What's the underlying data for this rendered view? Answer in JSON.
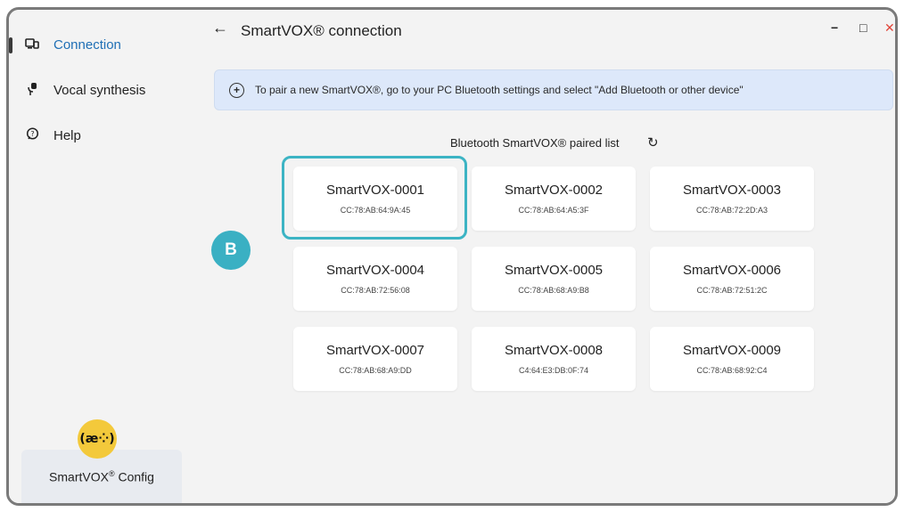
{
  "sidebar": {
    "items": [
      {
        "label": "Connection",
        "icon": "connection-icon",
        "active": true
      },
      {
        "label": "Vocal synthesis",
        "icon": "microphone-icon",
        "active": false
      },
      {
        "label": "Help",
        "icon": "help-icon",
        "active": false
      }
    ],
    "config": {
      "logo_text": "(æ⁘)",
      "label": "SmartVOX",
      "label_sup": "®",
      "label_suffix": " Config"
    }
  },
  "header": {
    "back": "←",
    "title": "SmartVOX® connection",
    "minimize": "−",
    "maximize": "□",
    "close": "✕"
  },
  "banner": {
    "icon": "+",
    "text": "To pair a new SmartVOX®, go to your PC Bluetooth settings and select \"Add Bluetooth or other device\""
  },
  "list": {
    "title": "Bluetooth SmartVOX® paired list",
    "refresh": "↻"
  },
  "devices": [
    {
      "name": "SmartVOX-0001",
      "mac": "CC:78:AB:64:9A:45"
    },
    {
      "name": "SmartVOX-0002",
      "mac": "CC:78:AB:64:A5:3F"
    },
    {
      "name": "SmartVOX-0003",
      "mac": "CC:78:AB:72:2D:A3"
    },
    {
      "name": "SmartVOX-0004",
      "mac": "CC:78:AB:72:56:08"
    },
    {
      "name": "SmartVOX-0005",
      "mac": "CC:78:AB:68:A9:B8"
    },
    {
      "name": "SmartVOX-0006",
      "mac": "CC:78:AB:72:51:2C"
    },
    {
      "name": "SmartVOX-0007",
      "mac": "CC:78:AB:68:A9:DD"
    },
    {
      "name": "SmartVOX-0008",
      "mac": "C4:64:E3:DB:0F:74"
    },
    {
      "name": "SmartVOX-0009",
      "mac": "CC:78:AB:68:92:C4"
    }
  ],
  "annotation": {
    "badge": "B"
  },
  "colors": {
    "accent": "#3ab0c3",
    "banner": "#dde8fa",
    "logo": "#f3c93b",
    "active_label": "#1f6fb5",
    "close": "#e0453a"
  }
}
